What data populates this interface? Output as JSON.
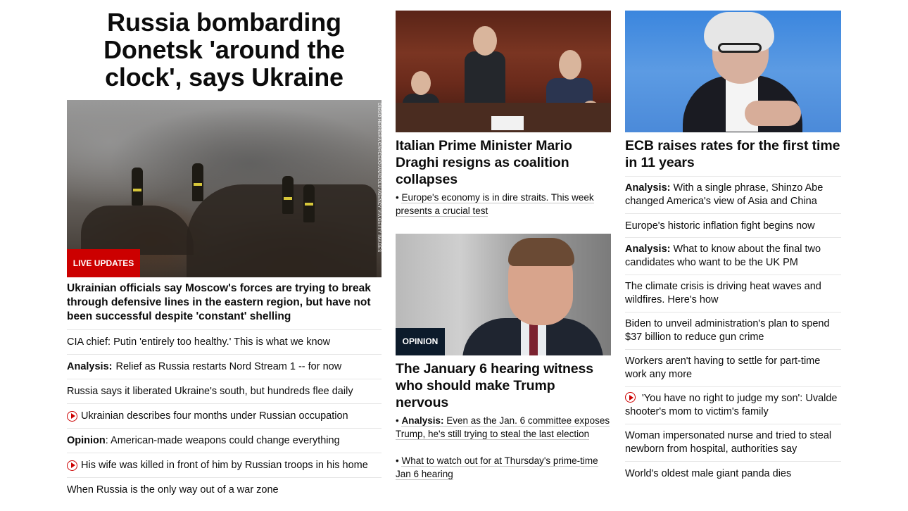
{
  "lead": {
    "headline": "Russia bombarding Donetsk 'around the clock', says Ukraine",
    "photo_credit": "DIEGO HERRERA CARCEDO/ANADOLU AGENCY VIA GETTY IMAGES",
    "badge": "LIVE UPDATES",
    "summary": "Ukrainian officials say Moscow's forces are trying to break through defensive lines in the eastern region, but have not been successful despite 'constant' shelling",
    "links": [
      {
        "label": "",
        "text": "CIA chief: Putin 'entirely too healthy.' This is what we know",
        "video": false
      },
      {
        "label": "Analysis:",
        "text": "Relief as Russia restarts Nord Stream 1 -- for now",
        "video": false
      },
      {
        "label": "",
        "text": "Russia says it liberated Ukraine's south, but hundreds flee daily",
        "video": false
      },
      {
        "label": "",
        "text": "Ukrainian describes four months under Russian occupation",
        "video": true
      },
      {
        "label": "Opinion",
        "text": ": American-made weapons could change everything",
        "video": false
      },
      {
        "label": "",
        "text": "His wife was killed in front of him by Russian troops in his home",
        "video": true
      },
      {
        "label": "",
        "text": "When Russia is the only way out of a war zone",
        "video": false
      }
    ]
  },
  "middle": {
    "story1": {
      "title": "Italian Prime Minister Mario Draghi resigns as coalition collapses",
      "bullet": "Europe's economy is in dire straits. This week presents a crucial test"
    },
    "story2": {
      "badge": "OPINION",
      "title": "The January 6 hearing witness who should make Trump nervous",
      "bullets": [
        {
          "label": "Analysis:",
          "text": "Even as the Jan. 6 committee exposes Trump, he's still trying to steal the last election"
        },
        {
          "label": "",
          "text": "What to watch out for at Thursday's prime-time Jan 6 hearing"
        }
      ]
    }
  },
  "right": {
    "title": "ECB raises rates for the first time in 11 years",
    "links": [
      {
        "label": "Analysis:",
        "text": "With a single phrase, Shinzo Abe changed America's view of Asia and China",
        "video": false
      },
      {
        "label": "",
        "text": "Europe's historic inflation fight begins now",
        "video": false
      },
      {
        "label": "Analysis:",
        "text": "What to know about the final two candidates who want to be the UK PM",
        "video": false
      },
      {
        "label": "",
        "text": "The climate crisis is driving heat waves and wildfires. Here's how",
        "video": false
      },
      {
        "label": "",
        "text": "Biden to unveil administration's plan to spend $37 billion to reduce gun crime",
        "video": false
      },
      {
        "label": "",
        "text": "Workers aren't having to settle for part-time work any more",
        "video": false
      },
      {
        "label": "",
        "text": "'You have no right to judge my son': Uvalde shooter's mom to victim's family",
        "video": true
      },
      {
        "label": "",
        "text": "Woman impersonated nurse and tried to steal newborn from hospital, authorities say",
        "video": false
      },
      {
        "label": "",
        "text": "World's oldest male giant panda dies",
        "video": false
      }
    ]
  }
}
